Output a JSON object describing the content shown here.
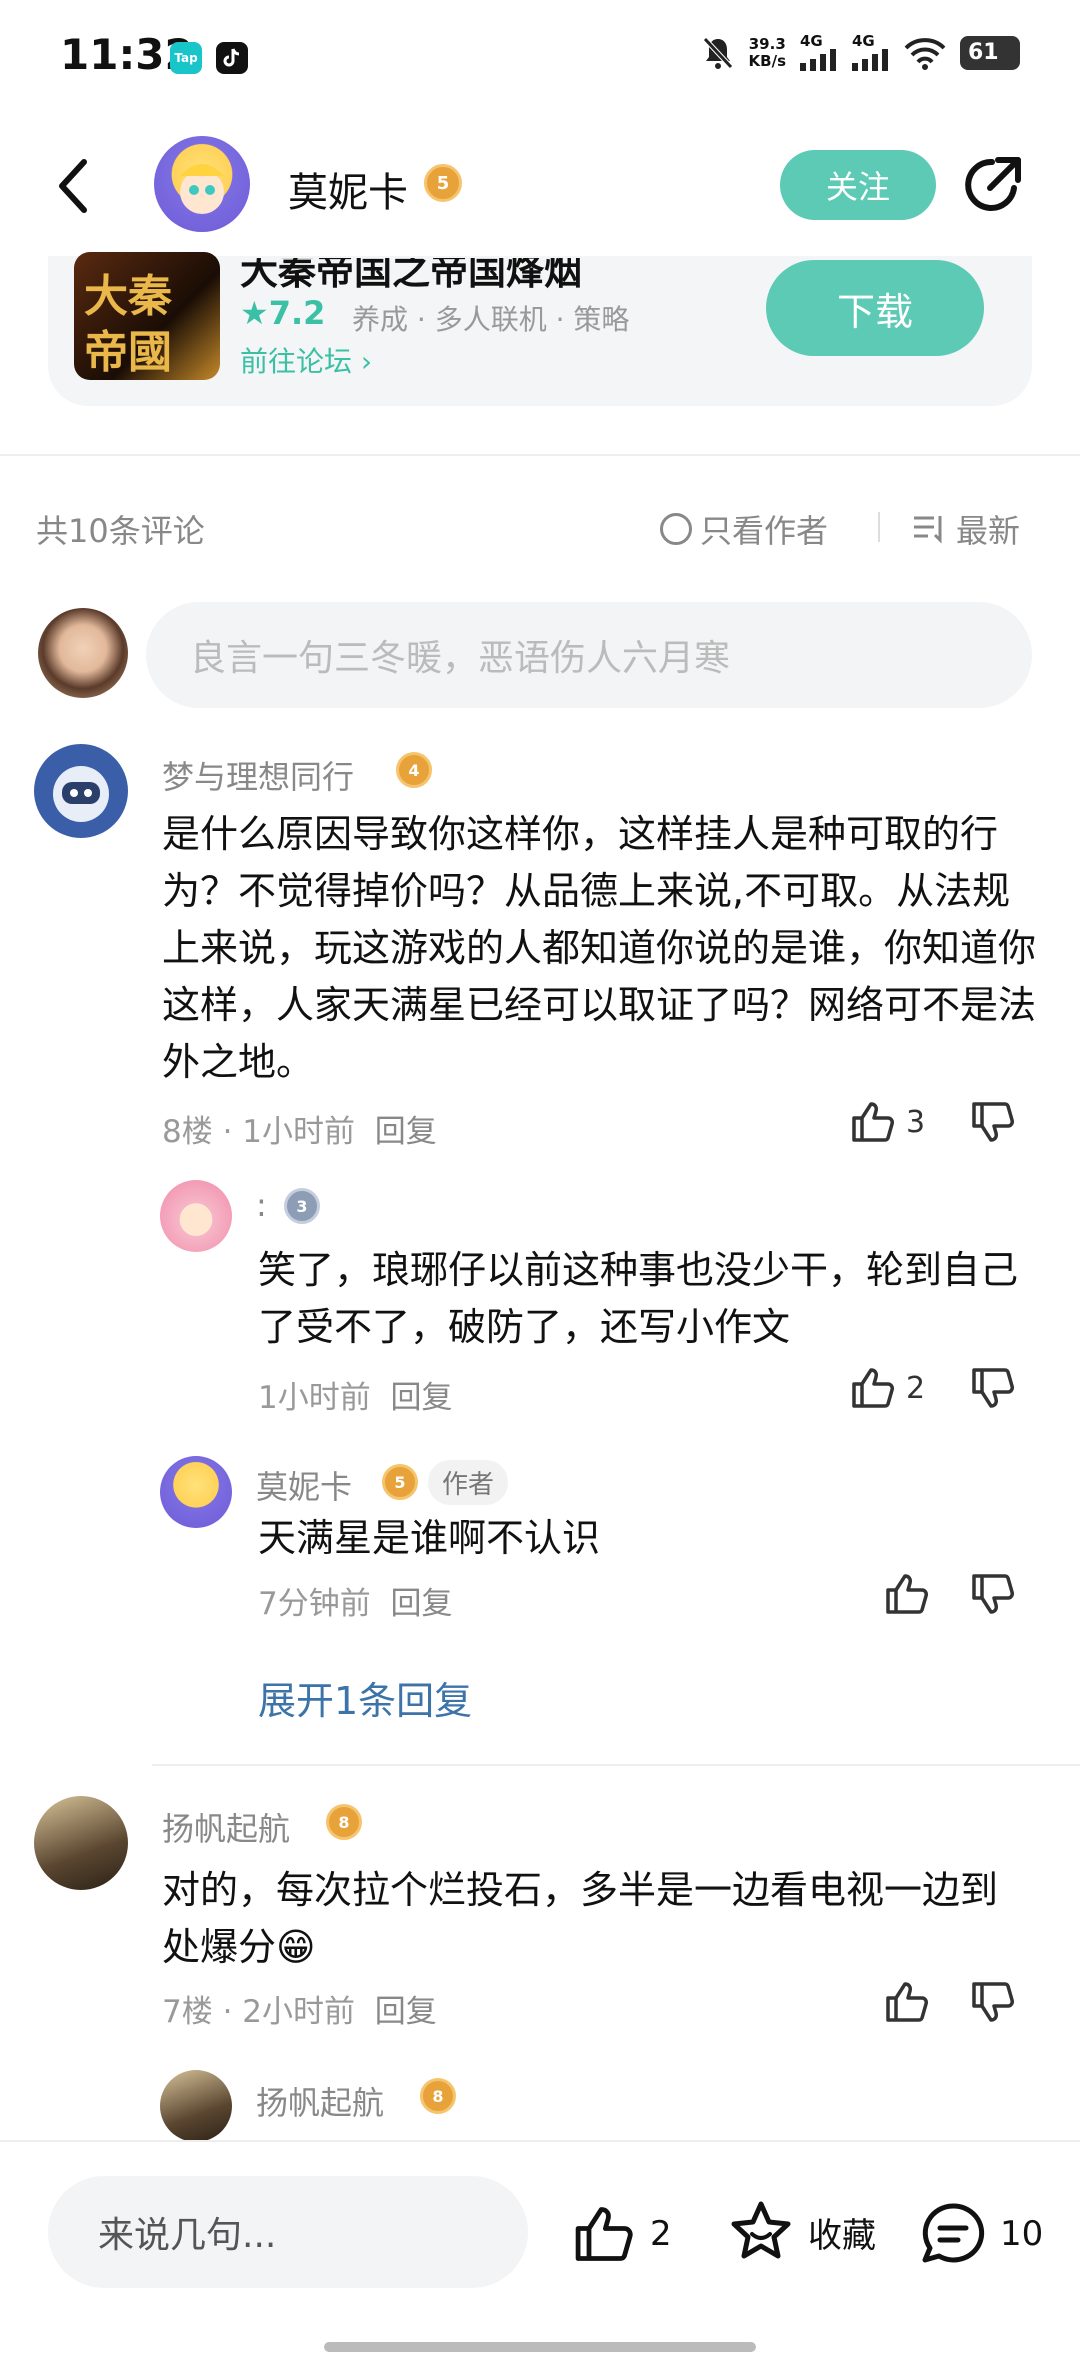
{
  "status_bar": {
    "time": "11:32",
    "app_badge_1": "Tap",
    "net_speed_value": "39.3",
    "net_speed_unit": "KB/s",
    "signal_1": "4G",
    "signal_2": "4G",
    "battery": "61"
  },
  "header": {
    "name": "莫妮卡",
    "level": "5",
    "follow_label": "关注"
  },
  "game_card": {
    "title": "大秦帝国之帝国烽烟",
    "rating": "★7.2",
    "tags": "养成 · 多人联机 · 策略",
    "forum_link": "前往论坛 ›",
    "download_label": "下载",
    "icon_text_1": "大秦",
    "icon_text_2": "帝國"
  },
  "comments_header": {
    "count_label": "共10条评论",
    "author_only_label": "只看作者",
    "sort_label": "最新"
  },
  "comment_input": {
    "placeholder": "良言一句三冬暖，恶语伤人六月寒"
  },
  "comments": [
    {
      "username": "梦与理想同行",
      "level": "4",
      "text": "是什么原因导致你这样你，这样挂人是种可取的行为？不觉得掉价吗？从品德上来说,不可取。从法规上来说，玩这游戏的人都知道你说的是谁，你知道你这样，人家天满星已经可以取证了吗？网络可不是法外之地。",
      "floor": "8楼",
      "time": "1小时前",
      "reply_label": "回复",
      "likes": "3",
      "replies": [
        {
          "username": ":",
          "level": "3",
          "text": "笑了，琅琊仔以前这种事也没少干，轮到自己了受不了，破防了，还写小作文",
          "time": "1小时前",
          "reply_label": "回复",
          "likes": "2"
        },
        {
          "username": "莫妮卡",
          "level": "5",
          "author_tag": "作者",
          "text": "天满星是谁啊不认识",
          "time": "7分钟前",
          "reply_label": "回复"
        }
      ],
      "expand_label": "展开1条回复"
    },
    {
      "username": "扬帆起航",
      "level": "8",
      "text": "对的，每次拉个烂投石，多半是一边看电视一边到处爆分😁",
      "floor": "7楼",
      "time": "2小时前",
      "reply_label": "回复",
      "replies": [
        {
          "username": "扬帆起航",
          "level": "8"
        }
      ]
    }
  ],
  "bottom_bar": {
    "input_placeholder": "来说几句...",
    "likes": "2",
    "favorite_label": "收藏",
    "comments_count": "10"
  }
}
